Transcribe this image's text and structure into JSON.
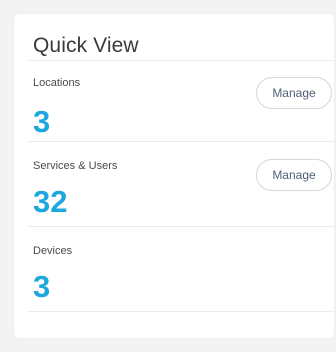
{
  "quick_view": {
    "title": "Quick View",
    "sections": [
      {
        "label": "Locations",
        "value": "3",
        "button_label": "Manage"
      },
      {
        "label": "Services & Users",
        "value": "32",
        "button_label": "Manage"
      },
      {
        "label": "Devices",
        "value": "3"
      }
    ]
  },
  "colors": {
    "accent": "#1ca8dd",
    "background": "#f3f3f3",
    "card": "#ffffff"
  }
}
